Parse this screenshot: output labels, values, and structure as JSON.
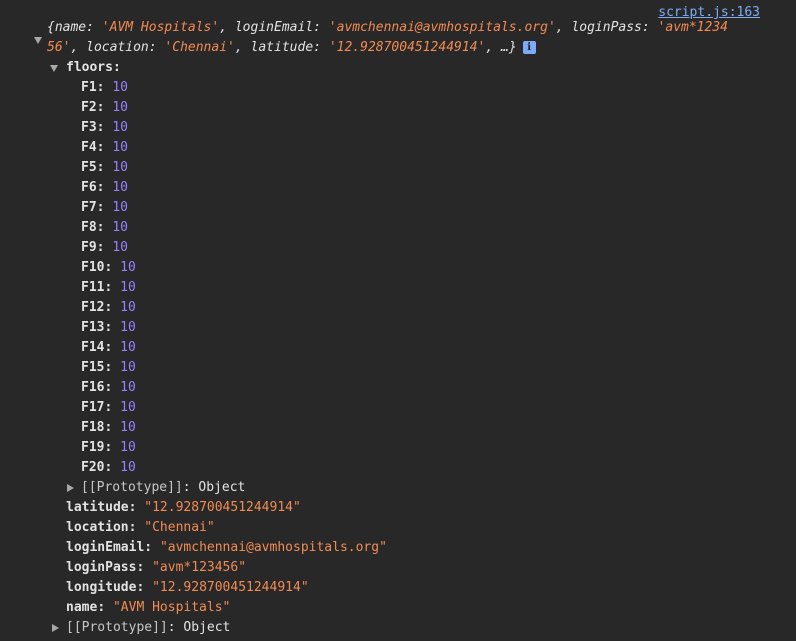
{
  "console": {
    "source_link": "script.js:163",
    "summary": {
      "open_brace": "{",
      "pairs": [
        {
          "key": "name",
          "value": "'AVM Hospitals'"
        },
        {
          "key": "loginEmail",
          "value": "'avmchennai@avmhospitals.org'"
        },
        {
          "key": "loginPass",
          "value": "'avm*123456'"
        },
        {
          "key": "location",
          "value": "'Chennai'"
        },
        {
          "key": "latitude",
          "value": "'12.928700451244914'"
        }
      ],
      "line1": {
        "p1": "name",
        "v1": "'AVM Hospitals'",
        "p2": "loginEmail",
        "v2": "'avmchennai@avmhospitals.org'",
        "p3": "loginPass",
        "v3a": "'avm*1234"
      },
      "line2": {
        "v3b": "56'",
        "p4": "location",
        "v4": "'Chennai'",
        "p5": "latitude",
        "v5": "'12.928700451244914'",
        "tail": ", …}"
      },
      "info_glyph": "i"
    },
    "floors_label": "floors",
    "floors": [
      {
        "key": "F1",
        "value": "10"
      },
      {
        "key": "F2",
        "value": "10"
      },
      {
        "key": "F3",
        "value": "10"
      },
      {
        "key": "F4",
        "value": "10"
      },
      {
        "key": "F5",
        "value": "10"
      },
      {
        "key": "F6",
        "value": "10"
      },
      {
        "key": "F7",
        "value": "10"
      },
      {
        "key": "F8",
        "value": "10"
      },
      {
        "key": "F9",
        "value": "10"
      },
      {
        "key": "F10",
        "value": "10"
      },
      {
        "key": "F11",
        "value": "10"
      },
      {
        "key": "F12",
        "value": "10"
      },
      {
        "key": "F13",
        "value": "10"
      },
      {
        "key": "F14",
        "value": "10"
      },
      {
        "key": "F15",
        "value": "10"
      },
      {
        "key": "F16",
        "value": "10"
      },
      {
        "key": "F17",
        "value": "10"
      },
      {
        "key": "F18",
        "value": "10"
      },
      {
        "key": "F19",
        "value": "10"
      },
      {
        "key": "F20",
        "value": "10"
      }
    ],
    "prototype_label": "[[Prototype]]",
    "prototype_value": "Object",
    "properties": [
      {
        "key": "latitude",
        "value": "\"12.928700451244914\""
      },
      {
        "key": "location",
        "value": "\"Chennai\""
      },
      {
        "key": "loginEmail",
        "value": "\"avmchennai@avmhospitals.org\""
      },
      {
        "key": "loginPass",
        "value": "\"avm*123456\""
      },
      {
        "key": "longitude",
        "value": "\"12.928700451244914\""
      },
      {
        "key": "name",
        "value": "\"AVM Hospitals\""
      }
    ],
    "colors": {
      "background": "#282828",
      "link": "#7cacf8",
      "number": "#9980ff",
      "string": "#f28b54"
    }
  }
}
